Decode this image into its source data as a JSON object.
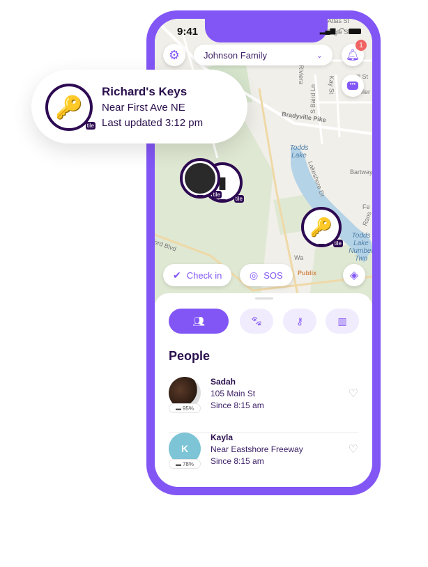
{
  "status_bar": {
    "time": "9:41"
  },
  "header": {
    "family_selector": "Johnson Family",
    "notification_count": "1"
  },
  "map": {
    "labels": [
      "Atlas St",
      "Eagle St",
      "Riviera",
      "S Baird Ln",
      "Kay St",
      "Fowler St",
      "Bradyville Pike",
      "Lakeshore Dr",
      "Bartway Dr",
      "Fe",
      "Rans",
      "ford Blvd",
      "Wa",
      "Publix",
      "rill St"
    ],
    "lakes": [
      "Todds Lake",
      "Todds Lake Number Two"
    ],
    "tile_badge": "tile"
  },
  "map_actions": {
    "check_in": "Check in",
    "sos": "SOS"
  },
  "tabs": [
    "people",
    "pets",
    "keys",
    "buildings"
  ],
  "people": {
    "heading": "People",
    "items": [
      {
        "name": "Sadah",
        "location": "105 Main St",
        "since": "Since 8:15 am",
        "battery": "95%"
      },
      {
        "name": "Kayla",
        "initial": "K",
        "location": "Near Eastshore Freeway",
        "since": "Since 8:15 am",
        "battery": "78%"
      }
    ]
  },
  "item_card": {
    "title": "Richard's Keys",
    "location": "Near First Ave NE",
    "updated": "Last updated 3:12 pm",
    "tile_badge": "tile"
  },
  "colors": {
    "brand": "#8256f5",
    "dark": "#2d0a52",
    "badge": "#f06464",
    "avatar_k": "#7cc4d6"
  }
}
